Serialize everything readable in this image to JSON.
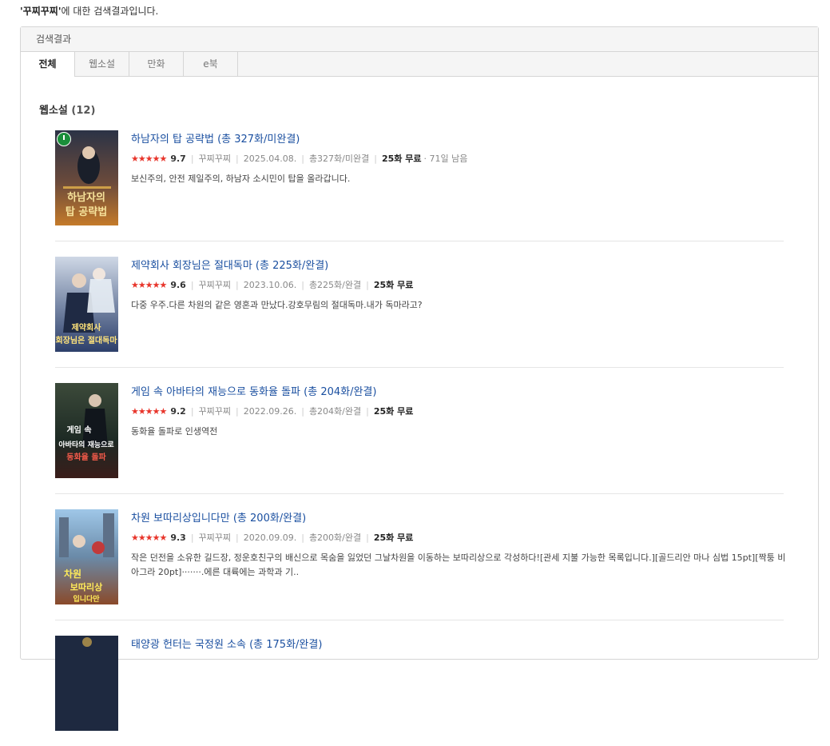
{
  "caption": {
    "query": "'꾸찌꾸찌'",
    "suffix": "에 대한 검색결과입니다."
  },
  "panel": {
    "header": "검색결과"
  },
  "tabs": [
    {
      "label": "전체",
      "active": true
    },
    {
      "label": "웹소설",
      "active": false
    },
    {
      "label": "만화",
      "active": false
    },
    {
      "label": "e북",
      "active": false
    }
  ],
  "section": {
    "title": "웹소설",
    "count": "(12)"
  },
  "colors": {
    "link": "#1a4fa0",
    "star": "#e8352b",
    "timer": "#1a8e3a"
  },
  "results": [
    {
      "title": "하남자의 탑 공략법 (총 327화/미완결)",
      "stars": "★★★★★",
      "score": "9.7",
      "author": "꾸찌꾸찌",
      "date": "2025.04.08.",
      "episodes": "총327화/미완결",
      "free": "25화 무료",
      "remain": "· 71일 남음",
      "desc": "보신주의, 안전 제일주의, 하남자 소시민이 탑을 올라갑니다.",
      "cover_text": "하남자의 탑 공략법",
      "cover_icon": "timer-icon"
    },
    {
      "title": "제약회사 회장님은 절대독마 (총 225화/완결)",
      "stars": "★★★★★",
      "score": "9.6",
      "author": "꾸찌꾸찌",
      "date": "2023.10.06.",
      "episodes": "총225화/완결",
      "free": "25화 무료",
      "remain": "",
      "desc": "다중 우주.다른 차원의 같은 영혼과 만났다.강호무림의 절대독마.내가 독마라고?",
      "cover_text": "제약회사 회장님은 절대독마"
    },
    {
      "title": "게임 속 아바타의 재능으로 동화율 돌파 (총 204화/완결)",
      "stars": "★★★★★",
      "score": "9.2",
      "author": "꾸찌꾸찌",
      "date": "2022.09.26.",
      "episodes": "총204화/완결",
      "free": "25화 무료",
      "remain": "",
      "desc": "동화율 돌파로 인생역전",
      "cover_text": "게임 속 아바타의 재능으로 동화율 돌파"
    },
    {
      "title": "차원 보따리상입니다만 (총 200화/완결)",
      "stars": "★★★★★",
      "score": "9.3",
      "author": "꾸찌꾸찌",
      "date": "2020.09.09.",
      "episodes": "총200화/완결",
      "free": "25화 무료",
      "remain": "",
      "desc": "작은 던전을 소유한 길드장, 정운호친구의 배신으로 목숨을 잃었던 그날차원을 이동하는 보따리상으로 각성하다![관세 지불 가능한 목록입니다.][골드리안 마나 심법 15pt][짝퉁 비아그라 20pt]·······.에른 대륙에는 과학과 기..",
      "cover_text": "차원 보따리상입니다만"
    },
    {
      "title": "태양광 헌터는 국정원 소속 (총 175화/완결)",
      "stars": "",
      "score": "",
      "author": "",
      "date": "",
      "episodes": "",
      "free": "",
      "remain": "",
      "desc": "",
      "cover_text": ""
    }
  ]
}
